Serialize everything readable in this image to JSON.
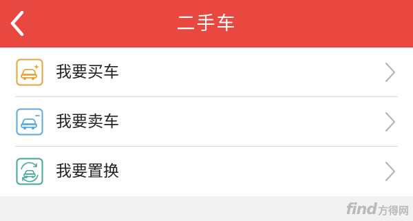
{
  "header": {
    "title": "二手车",
    "background": "#e8483f"
  },
  "menu": {
    "items": [
      {
        "label": "我要买车",
        "icon": "car-buy-icon",
        "accent": "#e8a23a"
      },
      {
        "label": "我要卖车",
        "icon": "car-sell-icon",
        "accent": "#5aa9dc"
      },
      {
        "label": "我要置换",
        "icon": "car-swap-icon",
        "accent": "#3ea89a"
      }
    ]
  },
  "watermark": {
    "brand": "find",
    "chinese": "方得网"
  }
}
